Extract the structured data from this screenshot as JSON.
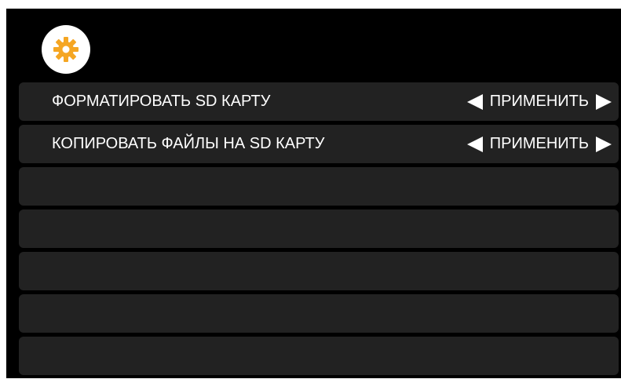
{
  "header": {
    "icon": "gear-icon",
    "icon_color": "#f5a623"
  },
  "menu": {
    "items": [
      {
        "label": "ФОРМАТИРОВАТЬ SD КАРТУ",
        "action": "ПРИМЕНИТЬ"
      },
      {
        "label": "КОПИРОВАТЬ ФАЙЛЫ НА SD КАРТУ",
        "action": "ПРИМЕНИТЬ"
      },
      {
        "label": "",
        "action": ""
      },
      {
        "label": "",
        "action": ""
      },
      {
        "label": "",
        "action": ""
      },
      {
        "label": "",
        "action": ""
      },
      {
        "label": "",
        "action": ""
      }
    ]
  },
  "colors": {
    "background": "#000000",
    "row": "#222222",
    "text": "#ffffff",
    "accent": "#f5a623"
  }
}
